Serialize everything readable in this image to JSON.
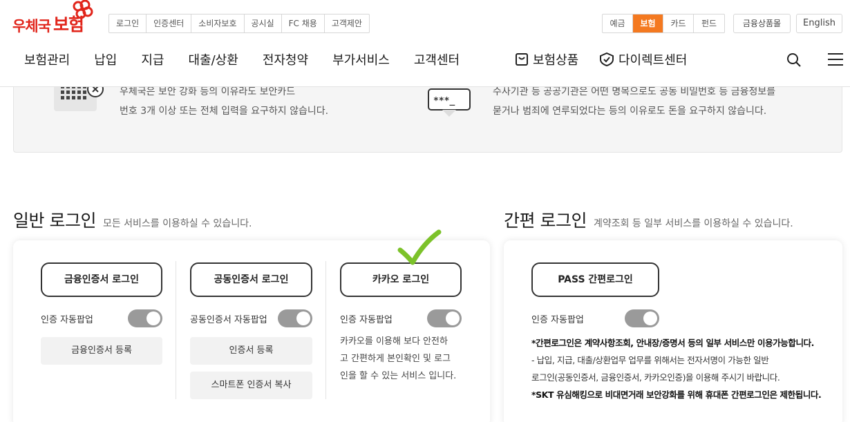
{
  "header": {
    "logo_part1": "우체국",
    "logo_part2": "보험",
    "util_links": [
      "로그인",
      "인증센터",
      "소비자보호",
      "공시실",
      "FC 채용",
      "고객제안"
    ],
    "segments": [
      "예금",
      "보험",
      "카드",
      "펀드"
    ],
    "active_segment": "보험",
    "financial_products": "금융상품몰",
    "english": "English",
    "nav": [
      "보험관리",
      "납입",
      "지급",
      "대출/상환",
      "전자청약",
      "부가서비스",
      "고객센터"
    ],
    "nav_special_1": "보험상품",
    "nav_special_2": "다이렉트센터",
    "accent_color": "#f47920",
    "brand_color": "#e1251b"
  },
  "warning": {
    "left_line1": "우체국은 보안 강화 등의 이유라도 보안카드",
    "left_line2": "번호 3개 이상 또는 전체 입력을 요구하지 않습니다.",
    "right_line1": "수사기관 등 공공기관은 어떤 명목으로도 공동 비밀번호 등 금융정보를",
    "right_line2": "묻거나 범죄에 연루되었다는 등의 이유로도 돈을 요구하지 않습니다.",
    "icon_right_text": "***_"
  },
  "general_login": {
    "title": "일반 로그인",
    "subtitle": "모든 서비스를 이용하실 수 있습니다.",
    "financial_cert_button": "금융인증서 로그인",
    "joint_cert_button": "공동인증서 로그인",
    "kakao_button": "카카오 로그인",
    "toggle_label_1": "인증 자동팝업",
    "toggle_label_2": "공동인증서 자동팝업",
    "toggle_label_3": "인증 자동팝업",
    "register_financial": "금융인증서 등록",
    "register_cert": "인증서 등록",
    "copy_smartphone": "스마트폰 인증서 복사",
    "kakao_desc_1": "카카오를 이용해 보다 안전하",
    "kakao_desc_2": "고 간편하게 본인확인 및 로그",
    "kakao_desc_3": "인을 할 수 있는 서비스 입니다."
  },
  "simple_login": {
    "title": "간편 로그인",
    "subtitle": "계약조회 등 일부 서비스를 이용하실 수 있습니다.",
    "pass_button": "PASS 간편로그인",
    "toggle_label": "인증 자동팝업",
    "note_1": "*간편로그인은 계약사항조회, 안내장/증명서 등의 일부 서비스만 이용가능합니다.",
    "note_2": "- 납입, 지급, 대출/상환업무 업무를 위해서는 전자서명이 가능한 일반",
    "note_3": "로그인(공동인증서, 금융인증서, 카카오인증)을 이용해 주시기 바랍니다.",
    "note_4": "*SKT 유심해킹으로 비대면거래 보안강화를 위해 휴대폰 간편로그인은 제한됩니다."
  }
}
